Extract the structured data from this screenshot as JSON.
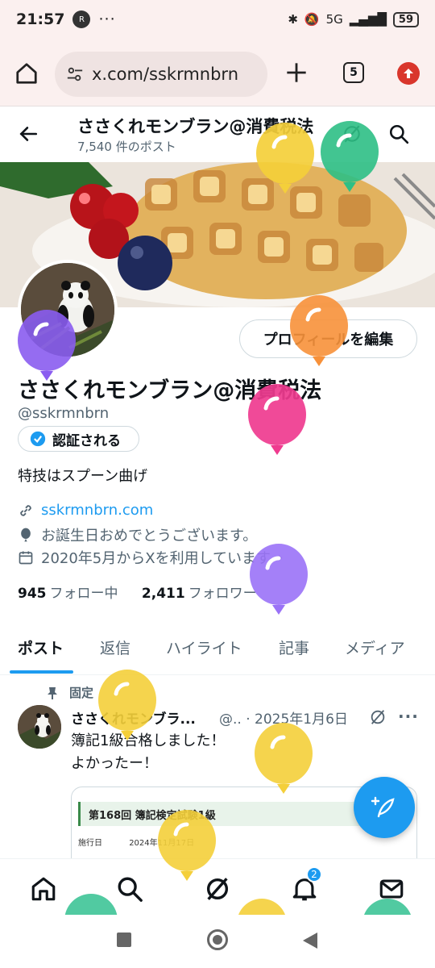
{
  "status": {
    "time": "21:57",
    "app_badge": "R",
    "overflow": "···",
    "signal": "5G",
    "battery": "59"
  },
  "browser": {
    "url": "x.com/sskrmnbrn",
    "tab_count": "5"
  },
  "header": {
    "title": "ささくれモンブラン@消費税法",
    "post_count": "7,540 件のポスト"
  },
  "profile": {
    "name": "ささくれモンブラン@消費税法",
    "handle": "@sskrmnbrn",
    "edit_label": "プロフィールを編集",
    "verify_label": "認証される",
    "bio": "特技はスプーン曲げ",
    "link": "sskrmnbrn.com",
    "birthday": "お誕生日おめでとうございます。",
    "joined": "2020年5月からXを利用しています",
    "following_count": "945",
    "following_label": "フォロー中",
    "followers_count": "2,411",
    "followers_label": "フォロワー"
  },
  "tabs": [
    "ポスト",
    "返信",
    "ハイライト",
    "記事",
    "メディア"
  ],
  "post": {
    "pinned_label": "固定",
    "name": "ささくれモンブラ...",
    "meta": "@.. · 2025年1月6日",
    "text": "簿記1級合格しました！\nよかったー！",
    "card_title": "第168回 簿記検定試験1級",
    "card_row_label": "施行日",
    "card_row_value": "2024年11月17日"
  },
  "notifications_badge": "2",
  "colors": {
    "accent": "#1d9bf0",
    "text": "#0f1419",
    "secondary": "#536471"
  }
}
